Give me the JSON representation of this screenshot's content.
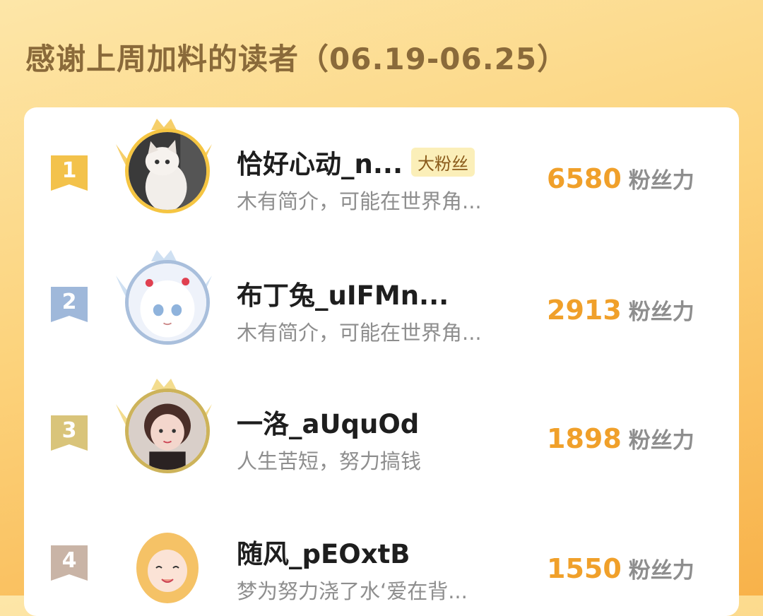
{
  "header": {
    "title": "感谢上周加料的读者（06.19-06.25）"
  },
  "readers": [
    {
      "rank": "1",
      "name": "恰好心动_n...",
      "badge": "大粉丝",
      "bio": "木有简介，可能在世界角...",
      "score": "6580",
      "unit": "粉丝力"
    },
    {
      "rank": "2",
      "name": "布丁兔_uIFMn...",
      "bio": "木有简介，可能在世界角...",
      "score": "2913",
      "unit": "粉丝力"
    },
    {
      "rank": "3",
      "name": "一洛_aUquOd",
      "bio": "人生苦短，努力搞钱",
      "score": "1898",
      "unit": "粉丝力"
    },
    {
      "rank": "4",
      "name": "随风_pEOxtB",
      "bio": "梦为努力浇了水‘爱在背...",
      "score": "1550",
      "unit": "粉丝力"
    }
  ],
  "colors": {
    "gold": "#f3c24b",
    "silver": "#9fb8da",
    "bronze": "#d9c47a",
    "score": "#f0a02a"
  }
}
